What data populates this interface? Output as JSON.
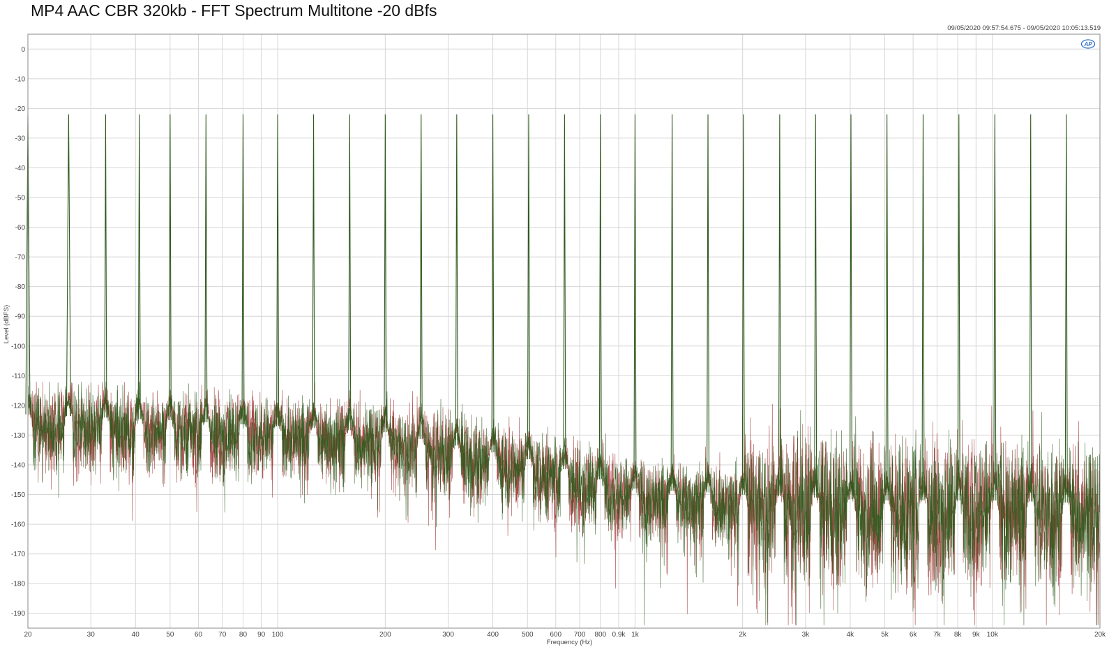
{
  "title": "MP4 AAC CBR 320kb  - FFT Spectrum Multitone -20 dBfs",
  "timestamp": "09/05/2020 09:57:54.675 - 09/05/2020 10:05:13.519",
  "logo_icon": "audio-precision-logo-icon",
  "colors": {
    "grid": "#d6d6d6",
    "axis": "#888888",
    "series_right": "#9b2a2a",
    "series_left": "#2e5a1c",
    "background": "#ffffff"
  },
  "chart_data": {
    "type": "line",
    "title": "MP4 AAC CBR 320kb  - FFT Spectrum Multitone -20 dBfs",
    "xlabel": "Frequency (Hz)",
    "ylabel": "Level (dBFS)",
    "xscale": "log",
    "xlim": [
      20,
      20000
    ],
    "ylim": [
      -195,
      5
    ],
    "grid": true,
    "y_ticks": [
      0,
      -10,
      -20,
      -30,
      -40,
      -50,
      -60,
      -70,
      -80,
      -90,
      -100,
      -110,
      -120,
      -130,
      -140,
      -150,
      -160,
      -170,
      -180,
      -190
    ],
    "y_tick_labels": [
      "0",
      "-10",
      "-20",
      "-30",
      "-40",
      "-50",
      "-60",
      "-70",
      "-80",
      "-90",
      "-100",
      "-110",
      "-120",
      "-130",
      "-140",
      "-150",
      "-160",
      "-170",
      "-180",
      "-190"
    ],
    "x_ticks": [
      20,
      30,
      40,
      50,
      60,
      70,
      80,
      90,
      100,
      200,
      300,
      400,
      500,
      600,
      700,
      800,
      900,
      1000,
      2000,
      3000,
      4000,
      5000,
      6000,
      7000,
      8000,
      9000,
      10000,
      20000
    ],
    "x_tick_labels": [
      "20",
      "30",
      "40",
      "50",
      "60",
      "70",
      "80",
      "90",
      "100",
      "200",
      "300",
      "400",
      "500",
      "600",
      "700",
      "800",
      "0.9k",
      "1k",
      "2k",
      "3k",
      "4k",
      "5k",
      "6k",
      "7k",
      "8k",
      "9k",
      "10k",
      "20k"
    ],
    "tone_level_dbfs": -22,
    "tone_frequencies_hz": [
      20,
      26,
      33,
      41,
      50,
      63,
      80,
      100,
      126,
      159,
      200,
      252,
      317,
      400,
      504,
      635,
      800,
      1000,
      1270,
      1600,
      2010,
      2540,
      3200,
      4020,
      5070,
      6400,
      8060,
      10160,
      12800,
      16100
    ],
    "noise_floor_profile": {
      "frequencies_hz": [
        20,
        50,
        100,
        200,
        500,
        1000,
        2000,
        5000,
        10000,
        20000
      ],
      "level_dbfs": [
        -127,
        -129,
        -131,
        -133,
        -142,
        -152,
        -154,
        -156,
        -156,
        -157
      ]
    },
    "legend": "none",
    "series": [
      {
        "color": "#9b2a2a"
      },
      {
        "color": "#2e5a1c"
      }
    ]
  }
}
